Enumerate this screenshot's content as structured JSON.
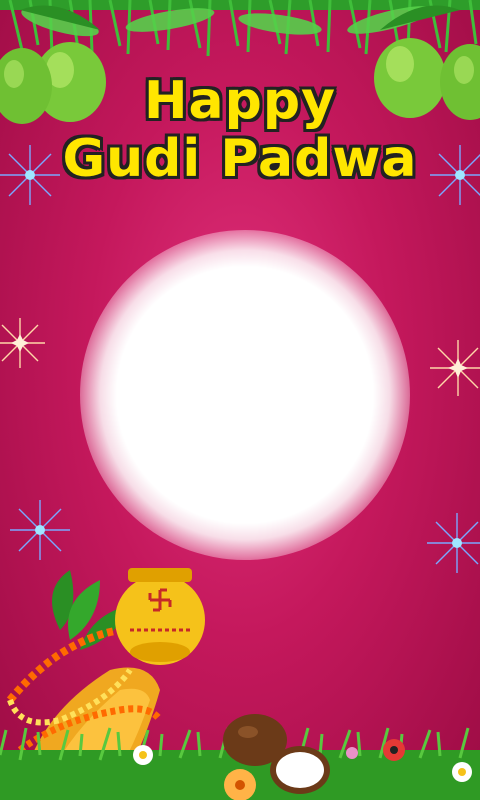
{
  "greeting": {
    "line1": "Happy",
    "line2": "Gudi Padwa"
  },
  "colors": {
    "background": "#c4185c",
    "title": "#ffe600",
    "title_outline": "#222222",
    "photo_area": "#ffffff"
  },
  "decorations": {
    "top": "mango-leaf-garland-icon",
    "corners": "green-mango-icon",
    "sparkles": "firework-sparkle-icon",
    "bottom_left": "gudi-kalash-icon",
    "bottom": "grass-flowers-coconut-icon"
  }
}
